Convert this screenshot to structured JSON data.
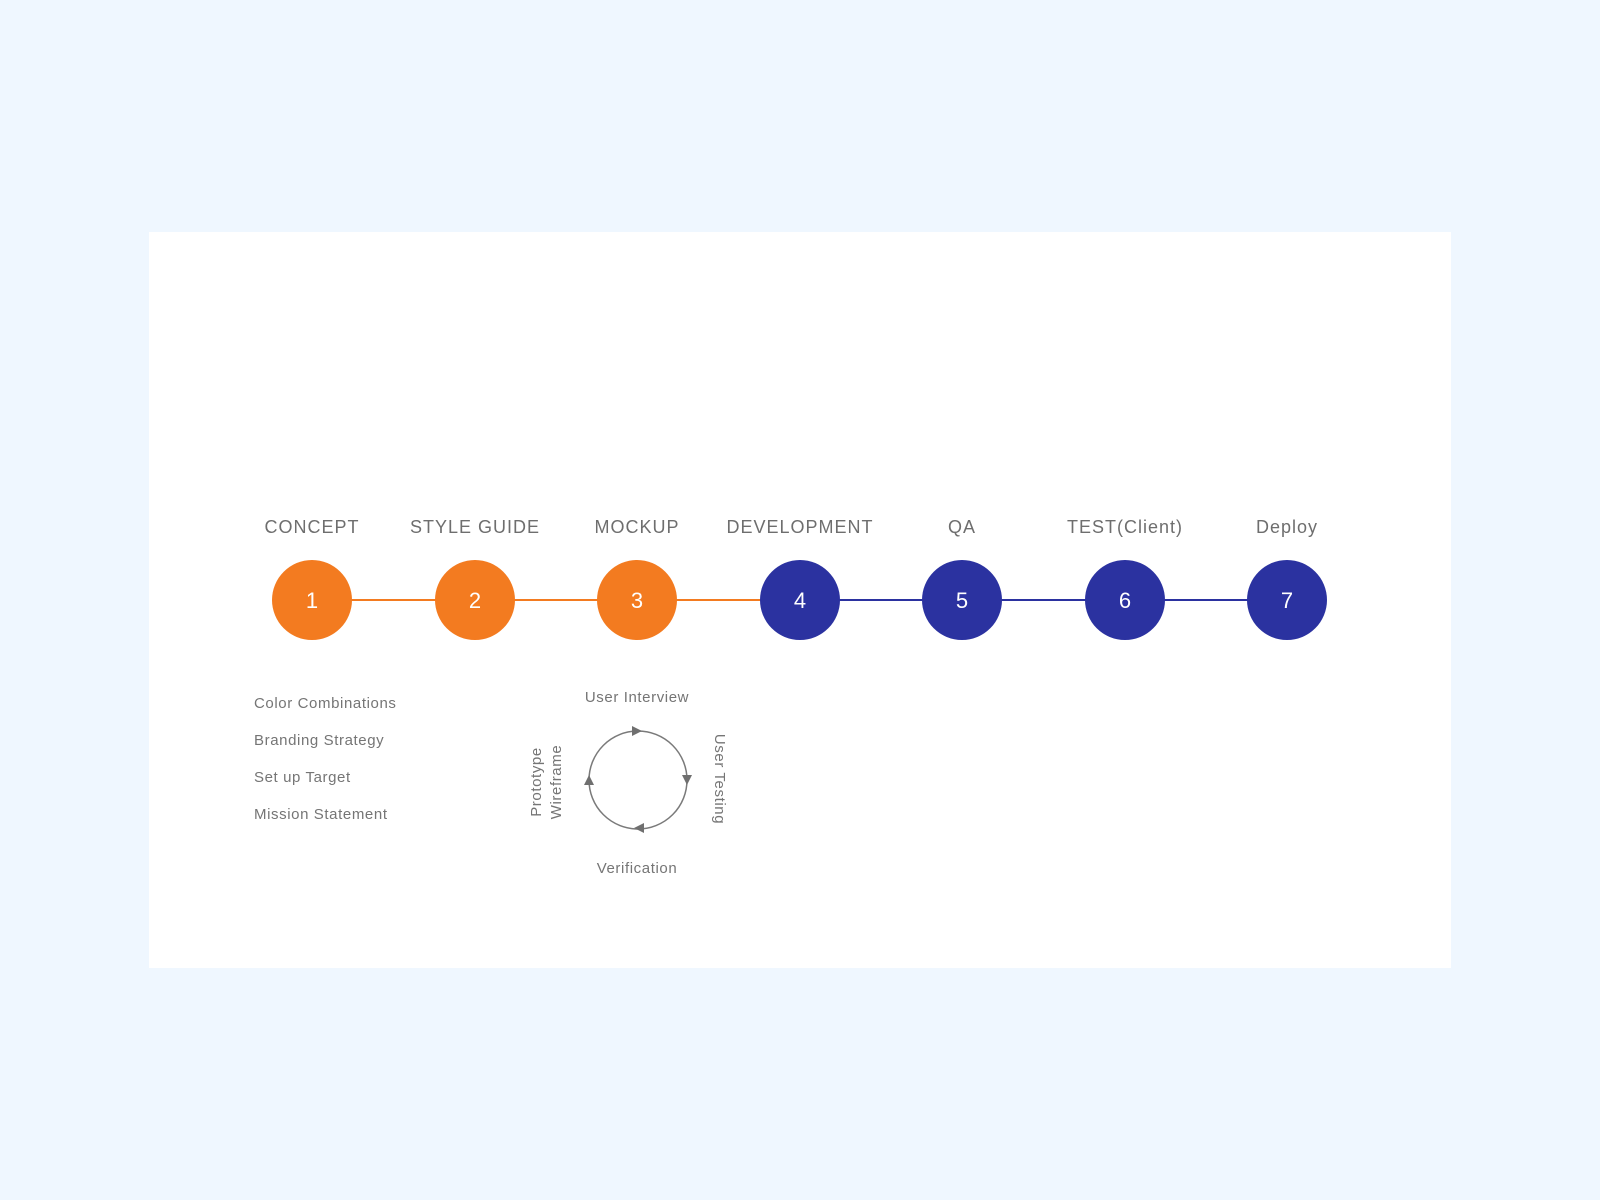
{
  "colors": {
    "background": "#eff7ff",
    "card": "#ffffff",
    "done": "#f37b20",
    "todo": "#2b32a0",
    "text": "#6e6e6e"
  },
  "steps": [
    {
      "number": "1",
      "label": "CONCEPT",
      "status": "done"
    },
    {
      "number": "2",
      "label": "STYLE GUIDE",
      "status": "done"
    },
    {
      "number": "3",
      "label": "MOCKUP",
      "status": "done"
    },
    {
      "number": "4",
      "label": "DEVELOPMENT",
      "status": "todo"
    },
    {
      "number": "5",
      "label": "QA",
      "status": "todo"
    },
    {
      "number": "6",
      "label": "TEST(Client)",
      "status": "todo"
    },
    {
      "number": "7",
      "label": "Deploy",
      "status": "todo"
    }
  ],
  "concept_items": [
    "Color Combinations",
    "Branding Strategy",
    "Set up Target",
    "Mission Statement"
  ],
  "cycle": {
    "top": "User Interview",
    "right": "User Testing",
    "bottom": "Verification",
    "left_line1": "Prototype",
    "left_line2": "Wireframe"
  },
  "icons": {
    "cycle": "cycle-arrows-icon"
  }
}
